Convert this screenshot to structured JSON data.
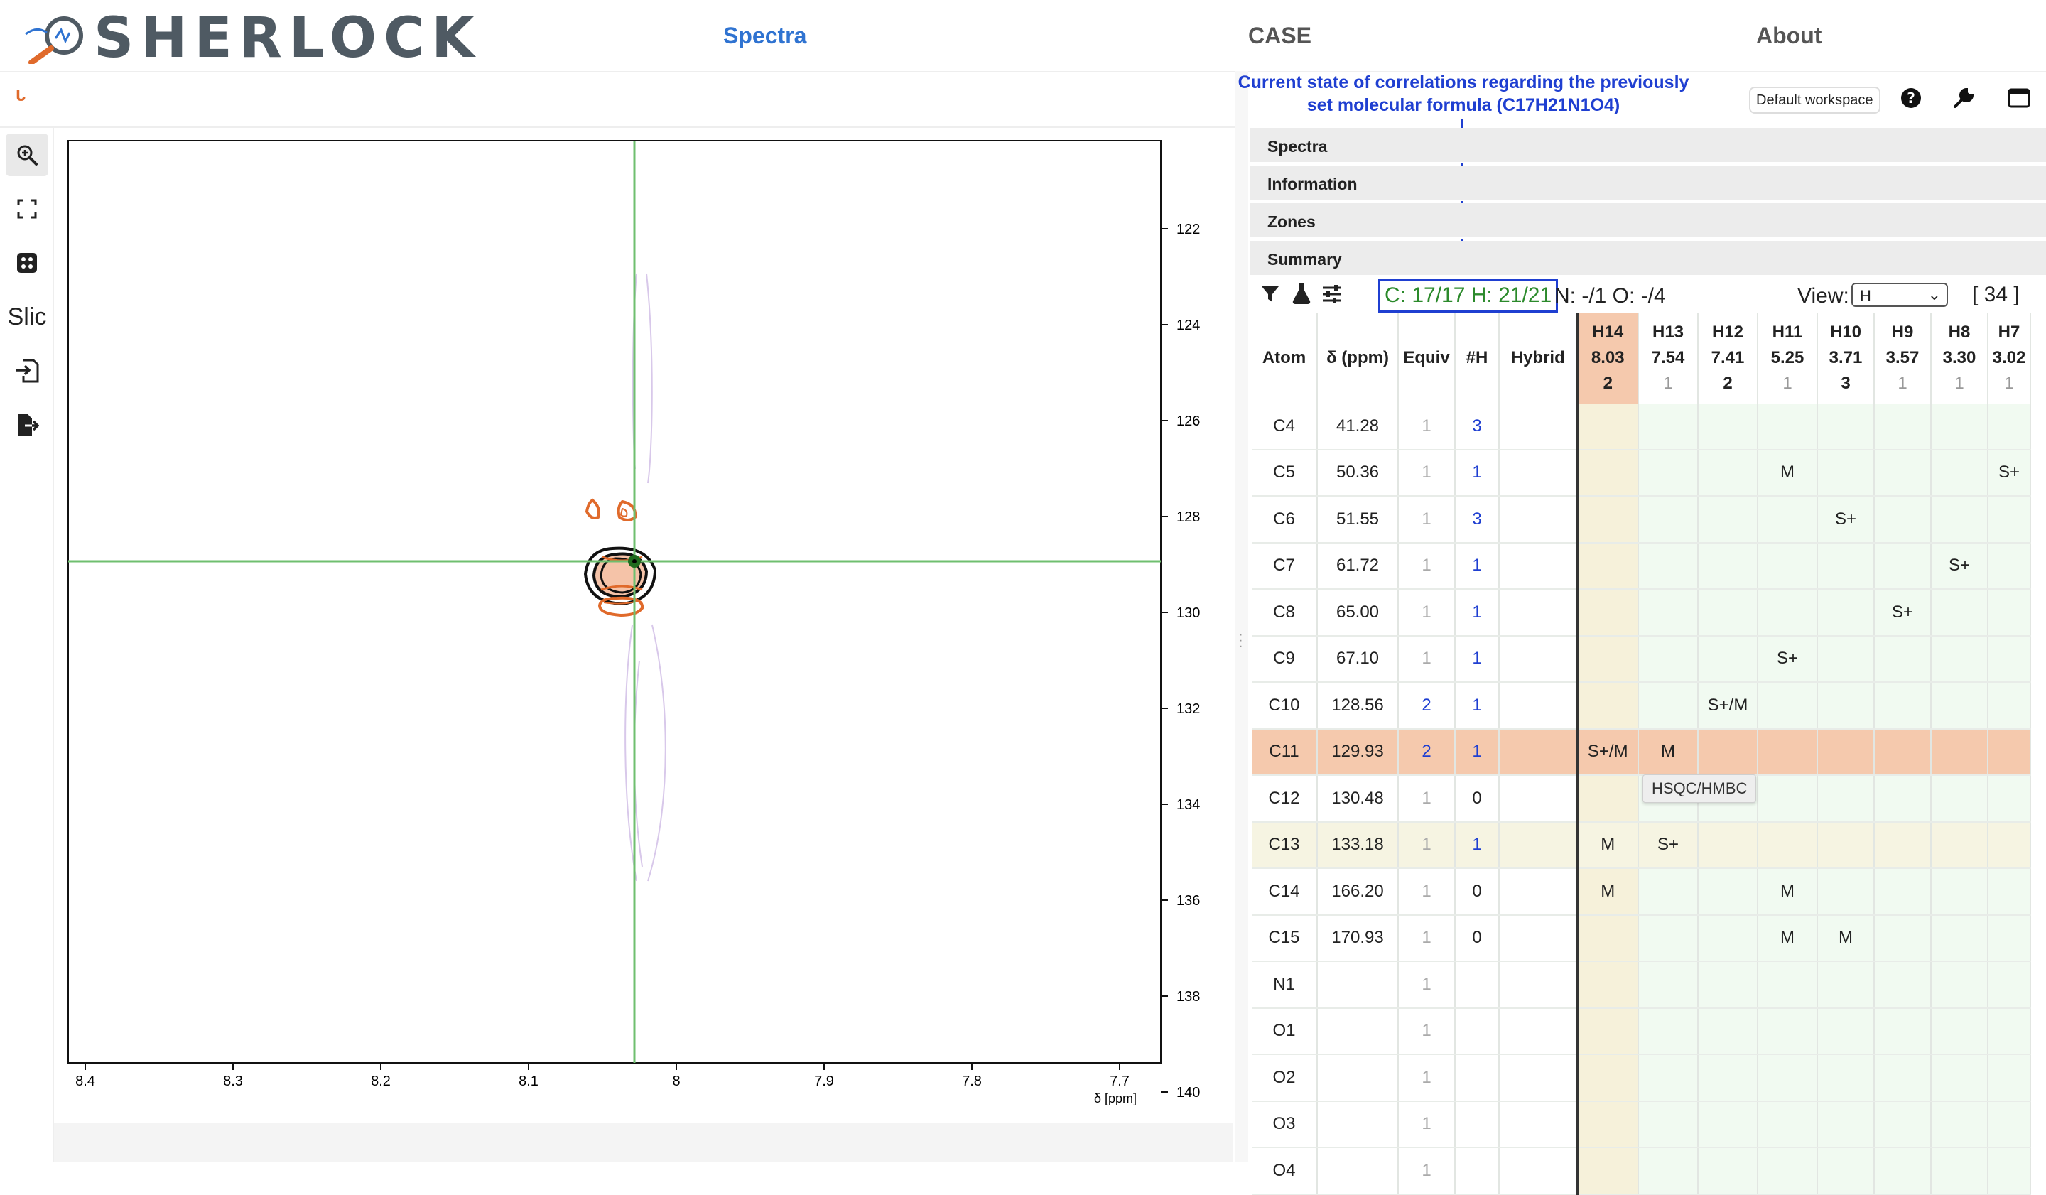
{
  "header": {
    "logo_text": "SHERLOCK",
    "nav": [
      {
        "label": "Spectra",
        "active": true
      },
      {
        "label": "CASE",
        "active": false
      },
      {
        "label": "About",
        "active": false
      }
    ]
  },
  "toolbar": {
    "left_logo": "ᒡ",
    "slice_label": "Slic",
    "tools": [
      "zoom-icon",
      "full-screen-icon",
      "peak-picking-icon",
      "slicing-icon",
      "import-icon",
      "export-icon"
    ]
  },
  "annotation": "Current state of correlations regarding the previously set molecular formula (C17H21N1O4)",
  "right_toolbar": {
    "workspace_label": "Default workspace"
  },
  "accordion": [
    "Spectra",
    "Information",
    "Zones",
    "Summary"
  ],
  "summary": {
    "counts_box": "C: 17/17  H: 21/21",
    "counts_other": "N: -/1  O: -/4",
    "view_label": "View:",
    "view_value": "H",
    "total": "[ 34 ]"
  },
  "spectrum": {
    "x_axis_label": "δ [ppm]",
    "x_ticks": [
      "8.4",
      "8.3",
      "8.2",
      "8.1",
      "8",
      "7.9",
      "7.8",
      "7.7"
    ],
    "y_ticks": [
      "122",
      "124",
      "126",
      "128",
      "130",
      "132",
      "134",
      "136",
      "138",
      "140"
    ],
    "colors": {
      "positive": "#111111",
      "negative": "#e06a2b",
      "fill": "#f5c3a8",
      "crosshair": "#6fbf6f"
    }
  },
  "table": {
    "fixed_headers": [
      "Atom",
      "δ (ppm)",
      "Equiv",
      "#H",
      "Hybrid"
    ],
    "h_columns": [
      {
        "atom": "H14",
        "shift": "8.03",
        "equiv": "2"
      },
      {
        "atom": "H13",
        "shift": "7.54",
        "equiv": "1"
      },
      {
        "atom": "H12",
        "shift": "7.41",
        "equiv": "2"
      },
      {
        "atom": "H11",
        "shift": "5.25",
        "equiv": "1"
      },
      {
        "atom": "H10",
        "shift": "3.71",
        "equiv": "3"
      },
      {
        "atom": "H9",
        "shift": "3.57",
        "equiv": "1"
      },
      {
        "atom": "H8",
        "shift": "3.30",
        "equiv": "1"
      },
      {
        "atom": "H7",
        "shift": "3.02",
        "equiv": "1"
      }
    ],
    "rows": [
      {
        "atom": "C4",
        "shift": "41.28",
        "equiv": "1",
        "h": "3",
        "hybrid": "",
        "cells": [
          "",
          "",
          "",
          "",
          "",
          "",
          "",
          ""
        ]
      },
      {
        "atom": "C5",
        "shift": "50.36",
        "equiv": "1",
        "h": "1",
        "hybrid": "",
        "cells": [
          "",
          "",
          "",
          "M",
          "",
          "",
          "",
          "S+"
        ]
      },
      {
        "atom": "C6",
        "shift": "51.55",
        "equiv": "1",
        "h": "3",
        "hybrid": "",
        "cells": [
          "",
          "",
          "",
          "",
          "S+",
          "",
          "",
          ""
        ]
      },
      {
        "atom": "C7",
        "shift": "61.72",
        "equiv": "1",
        "h": "1",
        "hybrid": "",
        "cells": [
          "",
          "",
          "",
          "",
          "",
          "",
          "S+",
          ""
        ]
      },
      {
        "atom": "C8",
        "shift": "65.00",
        "equiv": "1",
        "h": "1",
        "hybrid": "",
        "cells": [
          "",
          "",
          "",
          "",
          "",
          "S+",
          "",
          ""
        ]
      },
      {
        "atom": "C9",
        "shift": "67.10",
        "equiv": "1",
        "h": "1",
        "hybrid": "",
        "cells": [
          "",
          "",
          "",
          "S+",
          "",
          "",
          "",
          ""
        ]
      },
      {
        "atom": "C10",
        "shift": "128.56",
        "equiv": "2",
        "h": "1",
        "hybrid": "",
        "cells": [
          "",
          "",
          "S+/M",
          "",
          "",
          "",
          "",
          ""
        ]
      },
      {
        "atom": "C11",
        "shift": "129.93",
        "equiv": "2",
        "h": "1",
        "hybrid": "",
        "cells": [
          "S+/M",
          "M",
          "",
          "",
          "",
          "",
          "",
          ""
        ]
      },
      {
        "atom": "C12",
        "shift": "130.48",
        "equiv": "1",
        "h": "0",
        "hybrid": "",
        "cells": [
          "",
          "",
          "",
          "",
          "",
          "",
          "",
          ""
        ]
      },
      {
        "atom": "C13",
        "shift": "133.18",
        "equiv": "1",
        "h": "1",
        "hybrid": "",
        "cells": [
          "M",
          "S+",
          "",
          "",
          "",
          "",
          "",
          ""
        ]
      },
      {
        "atom": "C14",
        "shift": "166.20",
        "equiv": "1",
        "h": "0",
        "hybrid": "",
        "cells": [
          "M",
          "",
          "",
          "M",
          "",
          "",
          "",
          ""
        ]
      },
      {
        "atom": "C15",
        "shift": "170.93",
        "equiv": "1",
        "h": "0",
        "hybrid": "",
        "cells": [
          "",
          "",
          "",
          "M",
          "M",
          "",
          "",
          ""
        ]
      },
      {
        "atom": "N1",
        "shift": "",
        "equiv": "1",
        "h": "",
        "hybrid": "",
        "cells": [
          "",
          "",
          "",
          "",
          "",
          "",
          "",
          ""
        ]
      },
      {
        "atom": "O1",
        "shift": "",
        "equiv": "1",
        "h": "",
        "hybrid": "",
        "cells": [
          "",
          "",
          "",
          "",
          "",
          "",
          "",
          ""
        ]
      },
      {
        "atom": "O2",
        "shift": "",
        "equiv": "1",
        "h": "",
        "hybrid": "",
        "cells": [
          "",
          "",
          "",
          "",
          "",
          "",
          "",
          ""
        ]
      },
      {
        "atom": "O3",
        "shift": "",
        "equiv": "1",
        "h": "",
        "hybrid": "",
        "cells": [
          "",
          "",
          "",
          "",
          "",
          "",
          "",
          ""
        ]
      },
      {
        "atom": "O4",
        "shift": "",
        "equiv": "1",
        "h": "",
        "hybrid": "",
        "cells": [
          "",
          "",
          "",
          "",
          "",
          "",
          "",
          ""
        ]
      }
    ],
    "selected_row": "C11",
    "highlighted_row": "C13",
    "selected_column": "H14",
    "tooltip": "HSQC/HMBC"
  }
}
